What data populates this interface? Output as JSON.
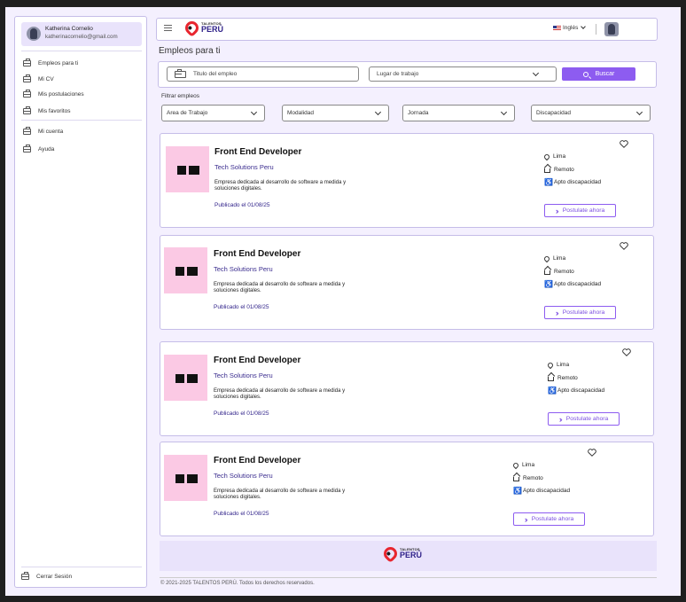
{
  "brand": {
    "top": "TALENTOS",
    "bottom": "PERÚ",
    "accent": "#e8262f",
    "primary": "#8d5cf0",
    "navy": "#2d1f88"
  },
  "user": {
    "name": "Katherina Cornelio",
    "email": "katherinacornelio@gmail.com"
  },
  "sidebar": {
    "items": [
      {
        "label": "Empleos para ti"
      },
      {
        "label": "Mi CV"
      },
      {
        "label": "Mis postulaciones"
      },
      {
        "label": "Mis favoritos"
      },
      {
        "label": "Mi cuenta"
      },
      {
        "label": "Ayuda"
      }
    ],
    "logout": "Cerrar Sesión"
  },
  "header": {
    "language": "Inglés"
  },
  "page": {
    "title": "Empleos para ti"
  },
  "search": {
    "job_placeholder": "Titulo del empleo",
    "location_placeholder": "Lugar de trabajo",
    "button": "Buscar"
  },
  "filters": {
    "label": "Filtrar empleos",
    "options": [
      {
        "label": "Area de Trabajo"
      },
      {
        "label": "Modalidad"
      },
      {
        "label": "Jornada"
      },
      {
        "label": "Discapacidad"
      }
    ]
  },
  "jobs": [
    {
      "title": "Front End Developer",
      "company": "Tech Solutions Peru",
      "description": "Empresa dedicada al desarrollo de software a medida y soluciones digitales.",
      "published": "Publicado el 01/08/25",
      "location": "Lima",
      "modality": "Remoto",
      "accessibility": "Apto discapacidad",
      "apply": "Postulate ahora"
    },
    {
      "title": "Front End Developer",
      "company": "Tech Solutions Peru",
      "description": "Empresa dedicada al desarrollo de software a medida y soluciones digitales.",
      "published": "Publicado el 01/08/25",
      "location": "Lima",
      "modality": "Remoto",
      "accessibility": "Apto discapacidad",
      "apply": "Postulate ahora"
    },
    {
      "title": "Front End Developer",
      "company": "Tech Solutions Peru",
      "description": "Empresa dedicada al desarrollo de software a medida y soluciones digitales.",
      "published": "Publicado el 01/08/25",
      "location": "Lima",
      "modality": "Remoto",
      "accessibility": "Apto discapacidad",
      "apply": "Postulate ahora"
    },
    {
      "title": "Front End Developer",
      "company": "Tech Solutions Peru",
      "description": "Empresa dedicada al desarrollo de software a medida y soluciones digitales.",
      "published": "Publicado el 01/08/25",
      "location": "Lima",
      "modality": "Remoto",
      "accessibility": "Apto discapacidad",
      "apply": "Postulate ahora"
    }
  ],
  "footer": {
    "copyright": "© 2021-2025 TALENTOS PERÚ. Todos los derechos reservados."
  }
}
